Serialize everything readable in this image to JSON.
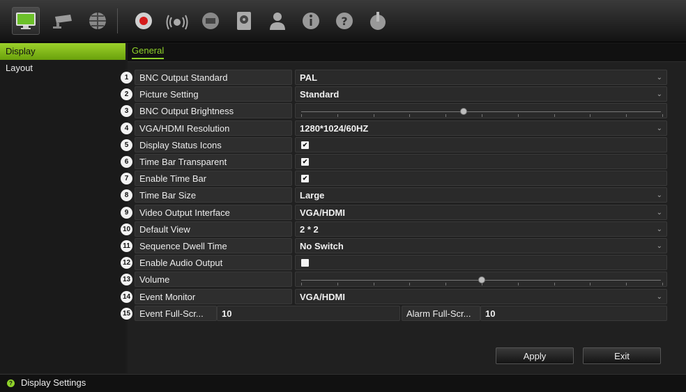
{
  "toolbar": {
    "icons": [
      "monitor-icon",
      "camera-icon",
      "network-icon",
      "record-icon",
      "alarm-icon",
      "device-icon",
      "storage-icon",
      "user-icon",
      "info-icon",
      "help-icon",
      "power-icon"
    ]
  },
  "sidebar": {
    "items": [
      {
        "label": "Display",
        "active": true
      },
      {
        "label": "Layout",
        "active": false
      }
    ]
  },
  "tabs": [
    {
      "label": "General",
      "active": true
    }
  ],
  "settings": [
    {
      "num": "1",
      "label": "BNC Output Standard",
      "value": "PAL",
      "type": "select"
    },
    {
      "num": "2",
      "label": "Picture Setting",
      "value": "Standard",
      "type": "select"
    },
    {
      "num": "3",
      "label": "BNC Output Brightness",
      "type": "slider",
      "level": 0.45
    },
    {
      "num": "4",
      "label": "VGA/HDMI Resolution",
      "value": "1280*1024/60HZ",
      "type": "select"
    },
    {
      "num": "5",
      "label": "Display Status Icons",
      "type": "checkbox",
      "checked": true
    },
    {
      "num": "6",
      "label": "Time Bar Transparent",
      "type": "checkbox",
      "checked": true
    },
    {
      "num": "7",
      "label": "Enable Time Bar",
      "type": "checkbox",
      "checked": true
    },
    {
      "num": "8",
      "label": "Time Bar Size",
      "value": "Large",
      "type": "select"
    },
    {
      "num": "9",
      "label": "Video Output Interface",
      "value": "VGA/HDMI",
      "type": "select"
    },
    {
      "num": "10",
      "label": "Default View",
      "value": "2 * 2",
      "type": "select"
    },
    {
      "num": "11",
      "label": "Sequence Dwell Time",
      "value": "No Switch",
      "type": "select"
    },
    {
      "num": "12",
      "label": "Enable Audio Output",
      "type": "checkbox",
      "checked": false
    },
    {
      "num": "13",
      "label": "Volume",
      "type": "slider",
      "level": 0.5
    },
    {
      "num": "14",
      "label": "Event Monitor",
      "value": "VGA/HDMI",
      "type": "select"
    }
  ],
  "fullscreen": {
    "num": "15",
    "event_label": "Event Full-Scr...",
    "event_value": "10",
    "alarm_label": "Alarm Full-Scr...",
    "alarm_value": "10"
  },
  "buttons": {
    "apply": "Apply",
    "exit": "Exit"
  },
  "status": {
    "text": "Display Settings"
  },
  "colors": {
    "accent": "#8fd22a",
    "background": "#1c1c1c"
  }
}
